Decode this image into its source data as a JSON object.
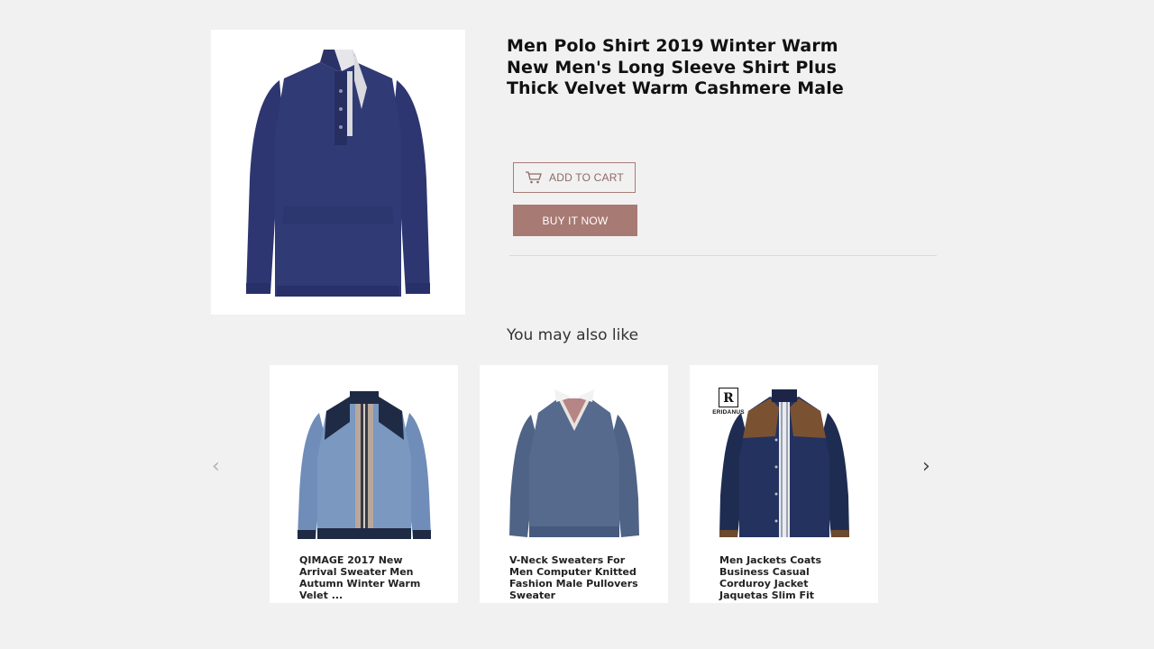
{
  "product": {
    "title": "Men Polo Shirt 2019 Winter Warm New Men's Long Sleeve Shirt Plus Thick Velvet Warm Cashmere Male",
    "add_to_cart_label": "ADD TO CART",
    "buy_now_label": "BUY IT NOW"
  },
  "related": {
    "heading": "You may also like",
    "prev_arrow": "‹",
    "next_arrow": "›",
    "items": [
      {
        "title": "QIMAGE 2017 New Arrival Sweater Men Autumn Winter Warm Velet ..."
      },
      {
        "title": "V-Neck Sweaters For Men Computer Knitted Fashion Male Pullovers Sweater"
      },
      {
        "title": "Men Jackets Coats Business Casual Corduroy Jacket Jaquetas Slim Fit",
        "brand": "ERIDANUS",
        "brand_mark": "R"
      }
    ]
  },
  "colors": {
    "accent": "#a87a74",
    "background": "#f2f1f1",
    "navy": "#2b3466"
  }
}
